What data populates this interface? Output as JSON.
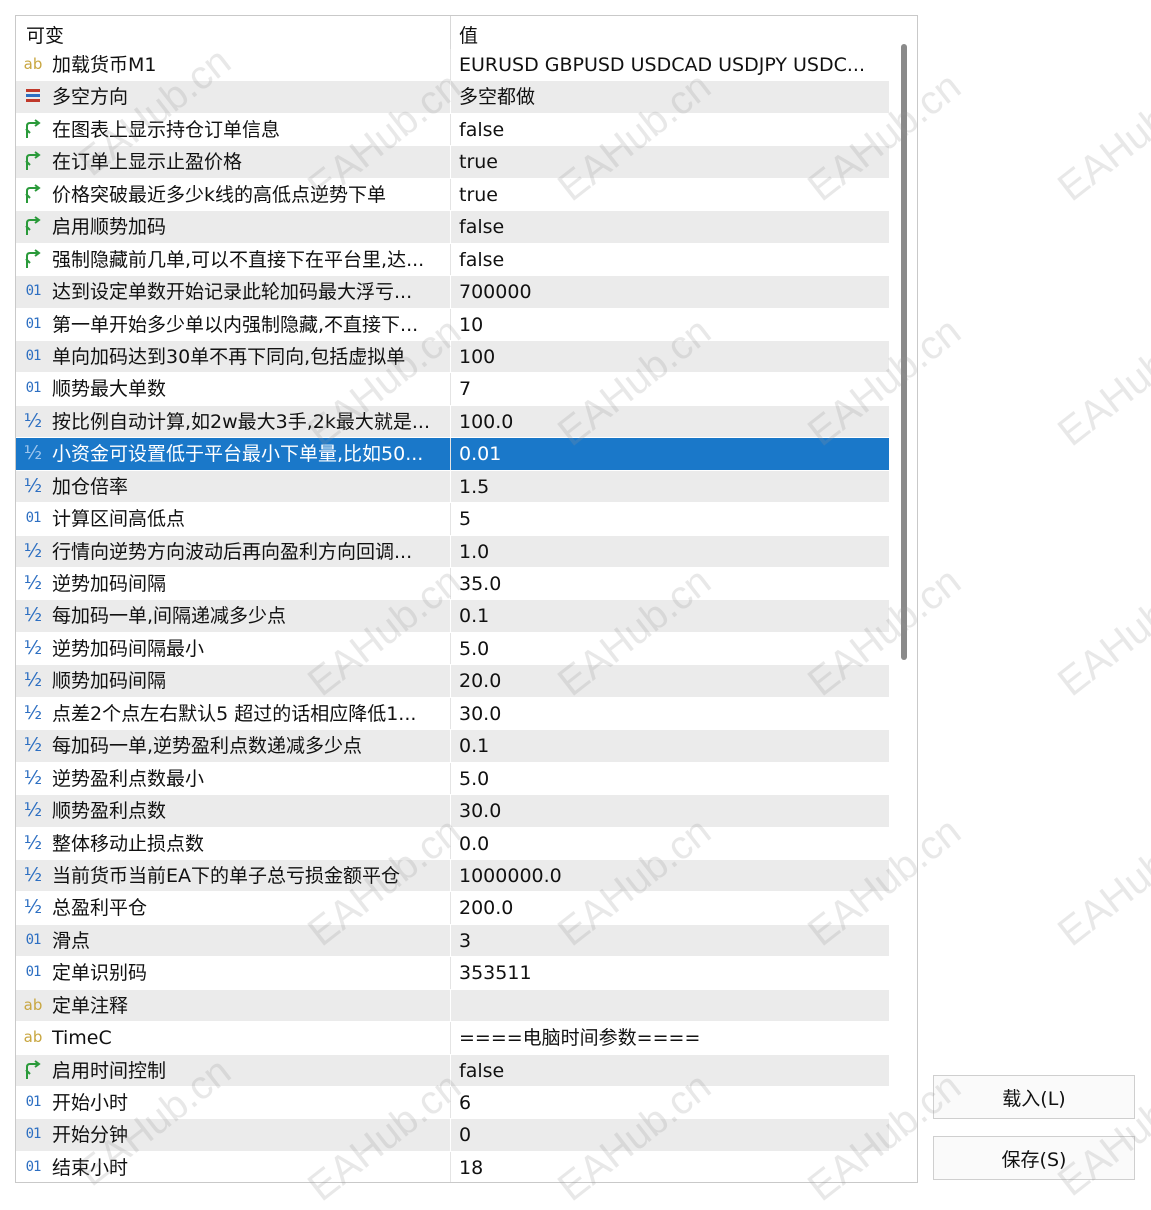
{
  "header": {
    "col_name": "可变",
    "col_value": "值"
  },
  "rows": [
    {
      "type": "text",
      "name": "加载货币M1",
      "value": "EURUSD GBPUSD USDCAD USDJPY USDC..."
    },
    {
      "type": "enum",
      "name": "多空方向",
      "value": "多空都做"
    },
    {
      "type": "bool",
      "name": "在图表上显示持仓订单信息",
      "value": "false"
    },
    {
      "type": "bool",
      "name": "在订单上显示止盈价格",
      "value": "true"
    },
    {
      "type": "bool",
      "name": "价格突破最近多少k线的高低点逆势下单",
      "value": "true"
    },
    {
      "type": "bool",
      "name": "启用顺势加码",
      "value": "false"
    },
    {
      "type": "bool",
      "name": "强制隐藏前几单,可以不直接下在平台里,达...",
      "value": "false"
    },
    {
      "type": "int",
      "name": "达到设定单数开始记录此轮加码最大浮亏...",
      "value": "700000"
    },
    {
      "type": "int",
      "name": "第一单开始多少单以内强制隐藏,不直接下...",
      "value": "10"
    },
    {
      "type": "int",
      "name": "单向加码达到30单不再下同向,包括虚拟单",
      "value": "100"
    },
    {
      "type": "int",
      "name": "顺势最大单数",
      "value": "7"
    },
    {
      "type": "double",
      "name": "按比例自动计算,如2w最大3手,2k最大就是...",
      "value": "100.0"
    },
    {
      "type": "double",
      "name": "小资金可设置低于平台最小下单量,比如50...",
      "value": "0.01",
      "selected": true
    },
    {
      "type": "double",
      "name": "加仓倍率",
      "value": "1.5"
    },
    {
      "type": "int",
      "name": "计算区间高低点",
      "value": "5"
    },
    {
      "type": "double",
      "name": "行情向逆势方向波动后再向盈利方向回调...",
      "value": "1.0"
    },
    {
      "type": "double",
      "name": "逆势加码间隔",
      "value": "35.0"
    },
    {
      "type": "double",
      "name": "每加码一单,间隔递减多少点",
      "value": "0.1"
    },
    {
      "type": "double",
      "name": "逆势加码间隔最小",
      "value": "5.0"
    },
    {
      "type": "double",
      "name": "顺势加码间隔",
      "value": "20.0"
    },
    {
      "type": "double",
      "name": "点差2个点左右默认5  超过的话相应降低1...",
      "value": "30.0"
    },
    {
      "type": "double",
      "name": "每加码一单,逆势盈利点数递减多少点",
      "value": "0.1"
    },
    {
      "type": "double",
      "name": "逆势盈利点数最小",
      "value": "5.0"
    },
    {
      "type": "double",
      "name": "顺势盈利点数",
      "value": "30.0"
    },
    {
      "type": "double",
      "name": "整体移动止损点数",
      "value": "0.0"
    },
    {
      "type": "double",
      "name": "当前货币当前EA下的单子总亏损金额平仓",
      "value": "1000000.0"
    },
    {
      "type": "double",
      "name": "总盈利平仓",
      "value": "200.0"
    },
    {
      "type": "int",
      "name": "滑点",
      "value": "3"
    },
    {
      "type": "int",
      "name": "定单识别码",
      "value": "353511"
    },
    {
      "type": "text",
      "name": "定单注释",
      "value": ""
    },
    {
      "type": "text",
      "name": "TimeC",
      "value": "====电脑时间参数===="
    },
    {
      "type": "bool",
      "name": "启用时间控制",
      "value": "false"
    },
    {
      "type": "int",
      "name": "开始小时",
      "value": "6"
    },
    {
      "type": "int",
      "name": "开始分钟",
      "value": "0"
    },
    {
      "type": "int",
      "name": "结束小时",
      "value": "18"
    }
  ],
  "buttons": {
    "load": "载入(L)",
    "save": "保存(S)"
  },
  "watermark": "EAHub.cn",
  "colors": {
    "selection": "#1a78c9",
    "bool_icon": "#2a9a3a",
    "int_icon": "#2d6fc2",
    "text_icon": "#c8a640",
    "enum_icon": "#c0392b"
  }
}
